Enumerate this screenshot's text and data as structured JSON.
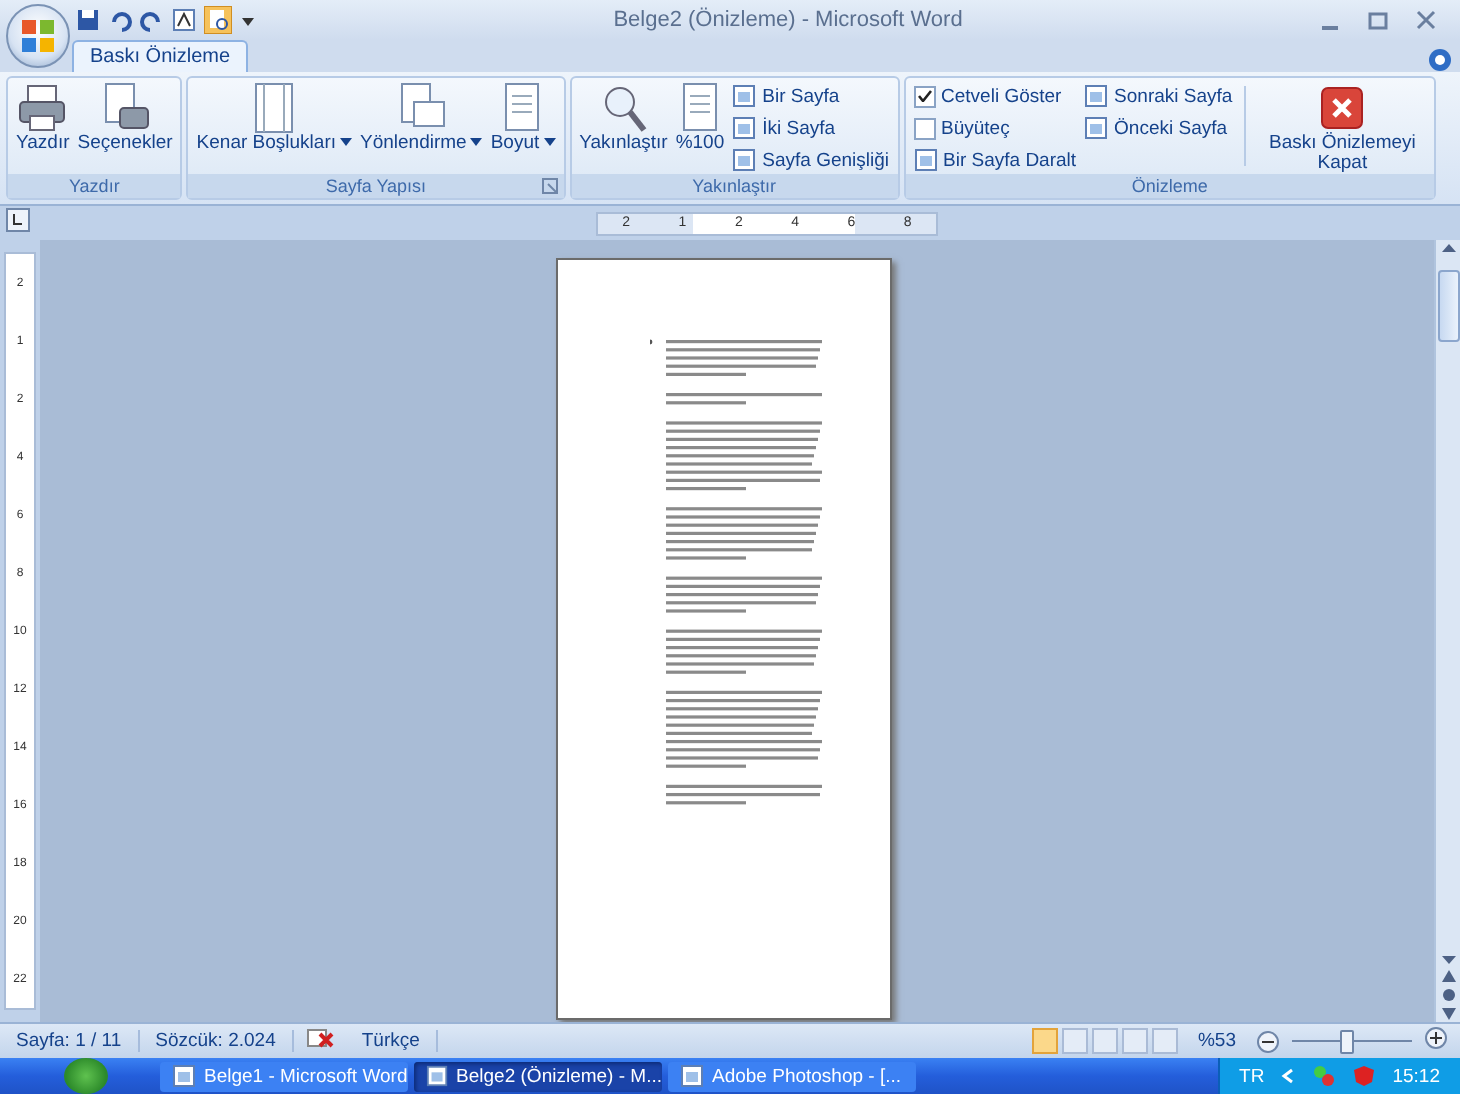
{
  "window": {
    "title": "Belge2 (Önizleme) - Microsoft Word"
  },
  "tabs": [
    {
      "label": "Baskı Önizleme",
      "selected": true
    }
  ],
  "groups": [
    {
      "label": "Yazdır",
      "launcher": false,
      "items": [
        {
          "kind": "large",
          "label": "Yazdır",
          "dropdown": false
        },
        {
          "kind": "large",
          "label": "Seçenekler",
          "dropdown": false
        }
      ]
    },
    {
      "label": "Sayfa Yapısı",
      "launcher": true,
      "items": [
        {
          "kind": "large",
          "label": "Kenar Boşlukları",
          "dropdown": true
        },
        {
          "kind": "large",
          "label": "Yönlendirme",
          "dropdown": true
        },
        {
          "kind": "large",
          "label": "Boyut",
          "dropdown": true
        }
      ]
    },
    {
      "label": "Yakınlaştır",
      "launcher": false,
      "items": [
        {
          "kind": "large",
          "label": "Yakınlaştır",
          "dropdown": false
        },
        {
          "kind": "large",
          "label": "%100",
          "dropdown": false
        },
        {
          "kind": "stack",
          "children": [
            {
              "kind": "small",
              "label": "Bir Sayfa"
            },
            {
              "kind": "small",
              "label": "İki Sayfa"
            },
            {
              "kind": "small",
              "label": "Sayfa Genişliği"
            }
          ]
        }
      ]
    },
    {
      "label": "Önizleme",
      "launcher": false,
      "items": [
        {
          "kind": "stack",
          "children": [
            {
              "kind": "checkbox",
              "label": "Cetveli Göster",
              "checked": true
            },
            {
              "kind": "checkbox",
              "label": "Büyüteç",
              "checked": false
            },
            {
              "kind": "small",
              "label": "Bir Sayfa Daralt"
            }
          ]
        },
        {
          "kind": "stack",
          "children": [
            {
              "kind": "small",
              "label": "Sonraki Sayfa"
            },
            {
              "kind": "small",
              "label": "Önceki Sayfa"
            }
          ]
        },
        {
          "kind": "divider"
        },
        {
          "kind": "large",
          "label": "Baskı Önizlemeyi Kapat",
          "dropdown": false
        }
      ]
    }
  ],
  "ruler": {
    "labels": [
      "2",
      "1",
      "2",
      "4",
      "6",
      "8"
    ]
  },
  "vertical_ruler": {
    "labels": [
      "2",
      "1",
      "2",
      "4",
      "6",
      "8",
      "10",
      "12",
      "14",
      "16",
      "18",
      "20",
      "22"
    ]
  },
  "status_bar": {
    "page": "Sayfa: 1 / 11",
    "words": "Sözcük: 2.024",
    "language": "Türkçe",
    "views": [
      {
        "selected": true
      },
      {
        "selected": false
      },
      {
        "selected": false
      },
      {
        "selected": false
      },
      {
        "selected": false
      }
    ],
    "zoom": "%53",
    "zoom_level": {
      "level": 0.45
    }
  },
  "taskbar": {
    "tasks": [
      {
        "label": "Belge1 - Microsoft Word",
        "selected": false
      },
      {
        "label": "Belge2 (Önizleme) - M...",
        "selected": true
      },
      {
        "label": "Adobe Photoshop - [...",
        "selected": false
      }
    ],
    "language": "TR",
    "clock": "15:12"
  }
}
